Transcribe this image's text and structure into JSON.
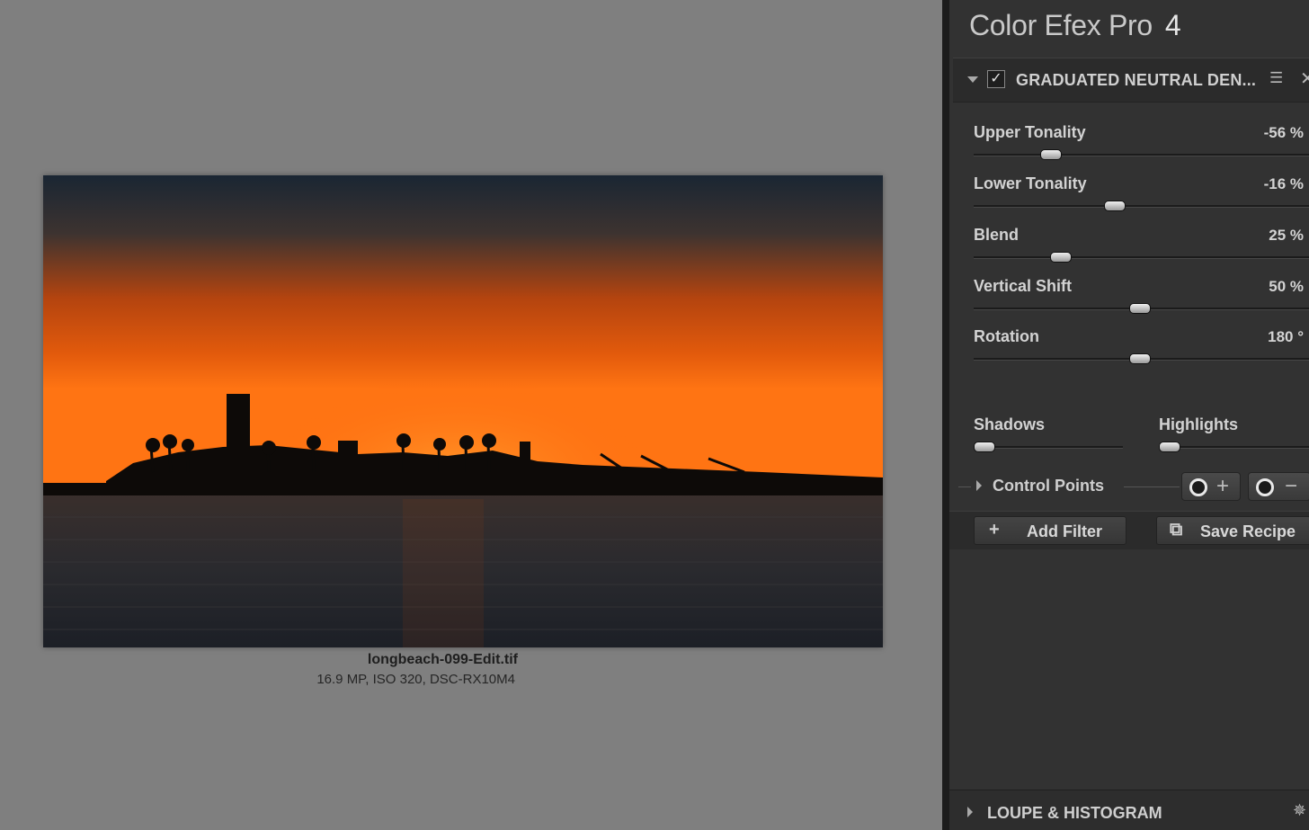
{
  "app": {
    "title": "Color Efex Pro",
    "version": "4"
  },
  "image_info": {
    "file_name": "longbeach-099-Edit.tif",
    "details": "16.9 MP, ISO 320, DSC-RX10M4"
  },
  "filter": {
    "name": "GRADUATED NEUTRAL DEN...",
    "enabled_mark": "✓",
    "params": [
      {
        "label": "Upper Tonality",
        "value": "-56 %",
        "slider_fraction": 0.23
      },
      {
        "label": "Lower Tonality",
        "value": "-16 %",
        "slider_fraction": 0.42
      },
      {
        "label": "Blend",
        "value": "25 %",
        "slider_fraction": 0.26
      },
      {
        "label": "Vertical Shift",
        "value": "50 %",
        "slider_fraction": 0.495
      },
      {
        "label": "Rotation",
        "value": "180 °",
        "slider_fraction": 0.495
      }
    ],
    "shadows": {
      "label": "Shadows",
      "slider_fraction": 0.07
    },
    "highlights": {
      "label": "Highlights",
      "slider_fraction": 0.07
    }
  },
  "control_points": {
    "label": "Control Points",
    "add_sign": "+",
    "remove_sign": "−"
  },
  "actions": {
    "add_filter_icon": "+",
    "add_filter_label": "Add Filter",
    "save_recipe_icon": "⧉",
    "save_recipe_label": "Save Recipe"
  },
  "loupe": {
    "label": "LOUPE & HISTOGRAM"
  },
  "icons": {
    "menu": "☰",
    "close": "✕",
    "pin": "✵"
  },
  "colors": {
    "panel_bg": "#323232",
    "canvas_bg": "#7f7f7f",
    "sunset_orange": "#ff6a10"
  }
}
